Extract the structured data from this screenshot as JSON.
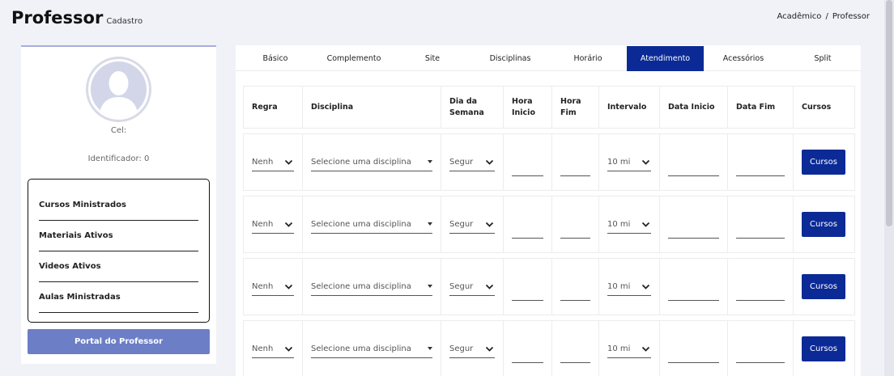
{
  "header": {
    "title": "Professor",
    "subtitle": "Cadastro",
    "breadcrumb": [
      "Acadêmico",
      "Professor"
    ],
    "breadcrumb_separator": "/"
  },
  "profile": {
    "cel_label": "Cel:",
    "identifier_label": "Identificador:",
    "identifier_value": "0",
    "stats": [
      "Cursos Ministrados",
      "Materiais Ativos",
      "Videos Ativos",
      "Aulas Ministradas"
    ],
    "portal_button": "Portal do Professor"
  },
  "tabs": [
    {
      "label": "Básico",
      "active": false
    },
    {
      "label": "Complemento",
      "active": false
    },
    {
      "label": "Site",
      "active": false
    },
    {
      "label": "Disciplinas",
      "active": false
    },
    {
      "label": "Horário",
      "active": false
    },
    {
      "label": "Atendimento",
      "active": true
    },
    {
      "label": "Acessórios",
      "active": false
    },
    {
      "label": "Split",
      "active": false
    }
  ],
  "table": {
    "columns": [
      "Regra",
      "Disciplina",
      "Dia da Semana",
      "Hora Inicio",
      "Hora Fim",
      "Intervalo",
      "Data Inicio",
      "Data Fim",
      "Cursos"
    ],
    "rows": [
      {
        "regra": "Nenh",
        "disciplina": "Selecione uma disciplina",
        "dia": "Segur",
        "hora_inicio": "",
        "hora_fim": "",
        "intervalo": "10 mi",
        "data_inicio": "",
        "data_fim": "",
        "cursos_button": "Cursos"
      },
      {
        "regra": "Nenh",
        "disciplina": "Selecione uma disciplina",
        "dia": "Segur",
        "hora_inicio": "",
        "hora_fim": "",
        "intervalo": "10 mi",
        "data_inicio": "",
        "data_fim": "",
        "cursos_button": "Cursos"
      },
      {
        "regra": "Nenh",
        "disciplina": "Selecione uma disciplina",
        "dia": "Segur",
        "hora_inicio": "",
        "hora_fim": "",
        "intervalo": "10 mi",
        "data_inicio": "",
        "data_fim": "",
        "cursos_button": "Cursos"
      },
      {
        "regra": "Nenh",
        "disciplina": "Selecione uma disciplina",
        "dia": "Segur",
        "hora_inicio": "",
        "hora_fim": "",
        "intervalo": "10 mi",
        "data_inicio": "",
        "data_fim": "",
        "cursos_button": "Cursos"
      }
    ]
  },
  "colors": {
    "background": "#f1f1f8",
    "primary": "#0b2a96",
    "portal_button": "#6c7ec6",
    "avatar": "#d2d6e8"
  }
}
